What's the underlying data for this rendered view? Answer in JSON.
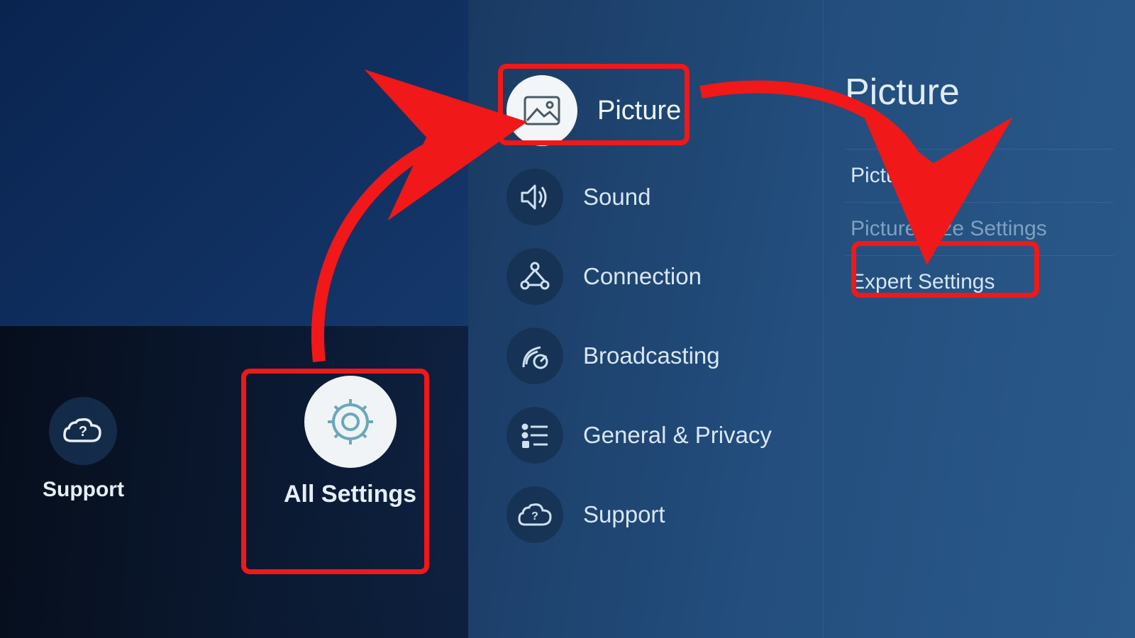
{
  "left": {
    "support": {
      "label": "Support",
      "icon": "cloud-question-icon"
    },
    "all_settings": {
      "label": "All Settings",
      "icon": "gear-icon"
    }
  },
  "settings_menu": {
    "items": [
      {
        "label": "Picture",
        "icon": "image-icon",
        "selected": true
      },
      {
        "label": "Sound",
        "icon": "speaker-icon"
      },
      {
        "label": "Connection",
        "icon": "network-icon"
      },
      {
        "label": "Broadcasting",
        "icon": "satellite-icon"
      },
      {
        "label": "General & Privacy",
        "icon": "list-icon"
      },
      {
        "label": "Support",
        "icon": "cloud-question-icon"
      }
    ]
  },
  "sub_panel": {
    "title": "Picture",
    "items": [
      {
        "label": "Picture Mode",
        "dim": false
      },
      {
        "label": "Picture Size Settings",
        "dim": true
      },
      {
        "label": "Expert Settings",
        "dim": false
      }
    ]
  }
}
